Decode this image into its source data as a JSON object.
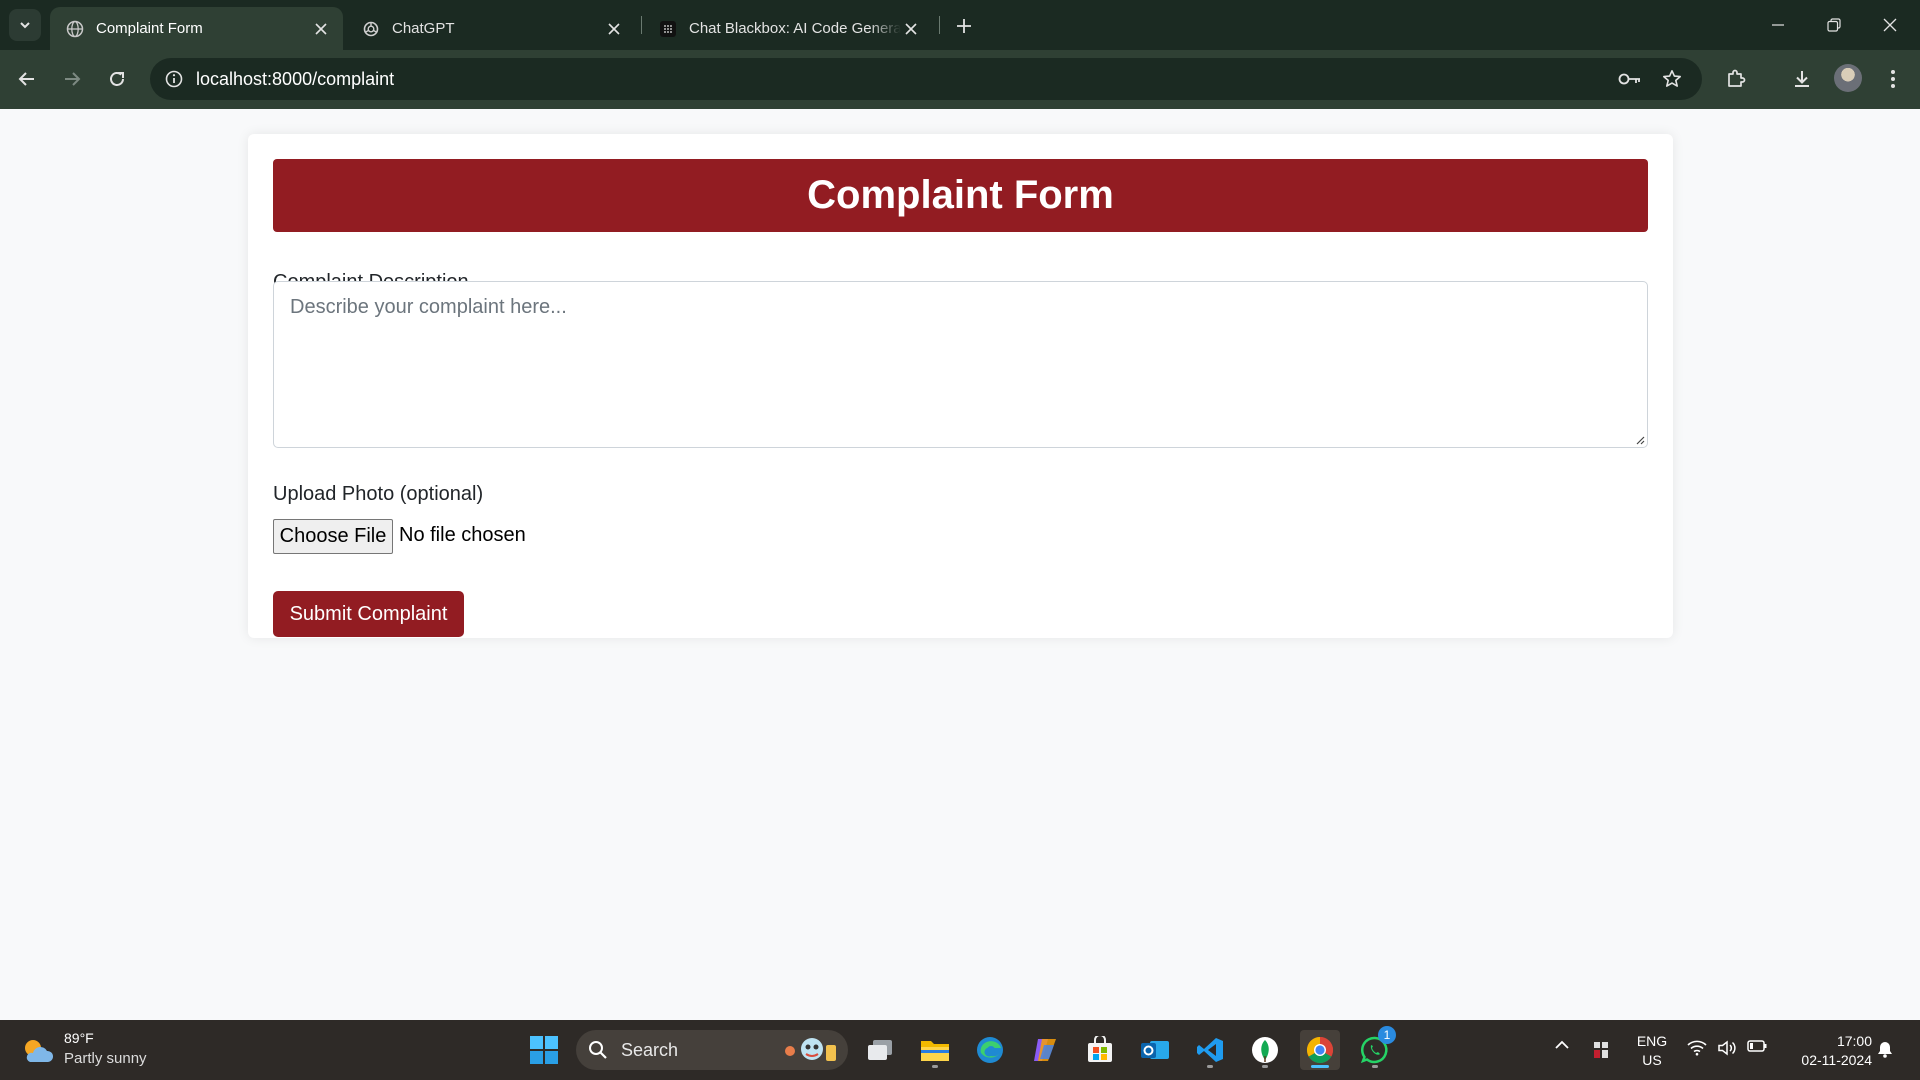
{
  "browser": {
    "tabs": [
      {
        "title": "Complaint Form",
        "active": true
      },
      {
        "title": "ChatGPT",
        "active": false
      },
      {
        "title": "Chat Blackbox: AI Code Generat",
        "active": false
      }
    ],
    "url": "localhost:8000/complaint"
  },
  "page": {
    "header": "Complaint Form",
    "description_label": "Complaint Description",
    "description_placeholder": "Describe your complaint here...",
    "upload_label": "Upload Photo (optional)",
    "file_button": "Choose File",
    "file_status": "No file chosen",
    "submit_label": "Submit Complaint"
  },
  "taskbar": {
    "weather_temp": "89°F",
    "weather_cond": "Partly sunny",
    "search_label": "Search",
    "whatsapp_badge": "1",
    "lang_1": "ENG",
    "lang_2": "US",
    "time": "17:00",
    "date": "02-11-2024"
  },
  "colors": {
    "brand": "#921c22",
    "chrome_frame": "#1b2a22",
    "chrome_toolbar": "#2f4034",
    "taskbar": "#2e2a27"
  }
}
